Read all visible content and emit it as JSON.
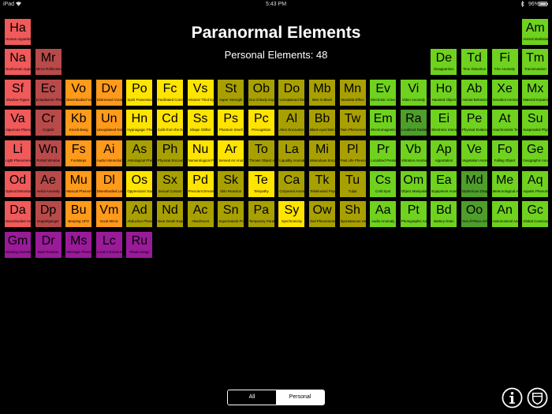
{
  "status_bar": {
    "device": "iPad",
    "time": "5:43 PM",
    "battery": "96%"
  },
  "header": {
    "title": "Paranormal Elements",
    "subtitle": "Personal Elements: 48"
  },
  "colors": {
    "red": "#F05A5A",
    "darkred": "#B84A4A",
    "orange": "#FF9A1A",
    "yellow": "#FFE400",
    "olive": "#A8A000",
    "darkolive": "#888800",
    "green": "#6FD21E",
    "darkgreen": "#4E9E2A",
    "purple": "#9A1A9A"
  },
  "elements": [
    {
      "s": "Ha",
      "n": "Human Apparition",
      "c": "red",
      "col": 0,
      "row": 0
    },
    {
      "s": "Am",
      "n": "Animal Mutilation",
      "c": "green",
      "col": 17,
      "row": 0
    },
    {
      "s": "Na",
      "n": "Nonhuman Apparition",
      "c": "red",
      "col": 0,
      "row": 1
    },
    {
      "s": "Mr",
      "n": "Mirror Reflection",
      "c": "darkred",
      "col": 1,
      "row": 1
    },
    {
      "s": "De",
      "n": "Disapparition",
      "c": "green",
      "col": 14,
      "row": 1
    },
    {
      "s": "Td",
      "n": "Time Distortion",
      "c": "green",
      "col": 15,
      "row": 1
    },
    {
      "s": "Fi",
      "n": "Fire Anomaly",
      "c": "green",
      "col": 16,
      "row": 1
    },
    {
      "s": "Tm",
      "n": "Transmutation",
      "c": "green",
      "col": 17,
      "row": 1
    },
    {
      "s": "Sf",
      "n": "Shadow Figure",
      "c": "red",
      "col": 0,
      "row": 2
    },
    {
      "s": "Ec",
      "n": "Ectoplasmic Phenomenon",
      "c": "darkred",
      "col": 1,
      "row": 2
    },
    {
      "s": "Vo",
      "n": "Disembodied Voice",
      "c": "orange",
      "col": 2,
      "row": 2
    },
    {
      "s": "Dv",
      "n": "Distressed Vocalization",
      "c": "orange",
      "col": 3,
      "row": 2
    },
    {
      "s": "Po",
      "n": "Spirit Possession",
      "c": "yellow",
      "col": 4,
      "row": 2
    },
    {
      "s": "Fc",
      "n": "Facilitated Communication",
      "c": "yellow",
      "col": 5,
      "row": 2
    },
    {
      "s": "Vs",
      "n": "Visions/ Third Eye",
      "c": "yellow",
      "col": 6,
      "row": 2
    },
    {
      "s": "St",
      "n": "Super Strength",
      "c": "olive",
      "col": 7,
      "row": 2
    },
    {
      "s": "Ob",
      "n": "Out of Body Experience",
      "c": "olive",
      "col": 8,
      "row": 2
    },
    {
      "s": "Do",
      "n": "Unexplained Disorientation",
      "c": "olive",
      "col": 9,
      "row": 2
    },
    {
      "s": "Mb",
      "n": "Men in Black",
      "c": "olive",
      "col": 10,
      "row": 2
    },
    {
      "s": "Mn",
      "n": "Mandela Effect",
      "c": "olive",
      "col": 11,
      "row": 2
    },
    {
      "s": "Ev",
      "n": "Electronic Voice Phenomenon",
      "c": "green",
      "col": 12,
      "row": 2
    },
    {
      "s": "Vi",
      "n": "Video Anomaly",
      "c": "green",
      "col": 13,
      "row": 2
    },
    {
      "s": "Ho",
      "n": "Haunted Object",
      "c": "green",
      "col": 14,
      "row": 2
    },
    {
      "s": "Ab",
      "n": "Animal Behavior",
      "c": "green",
      "col": 15,
      "row": 2
    },
    {
      "s": "Xe",
      "n": "Xenobiot Anomaly",
      "c": "green",
      "col": 16,
      "row": 2
    },
    {
      "s": "Mx",
      "n": "Material Expansion",
      "c": "green",
      "col": 17,
      "row": 2
    },
    {
      "s": "Va",
      "n": "Vaporous Phenomenon",
      "c": "red",
      "col": 0,
      "row": 3
    },
    {
      "s": "Cr",
      "n": "Cryptid",
      "c": "darkred",
      "col": 1,
      "row": 3
    },
    {
      "s": "Kb",
      "n": "Knock Bang",
      "c": "orange",
      "col": 2,
      "row": 3
    },
    {
      "s": "Un",
      "n": "Unexplained Noise",
      "c": "orange",
      "col": 3,
      "row": 3
    },
    {
      "s": "Hn",
      "n": "Hypnagogic Phenomenon",
      "c": "yellow",
      "col": 4,
      "row": 3
    },
    {
      "s": "Cd",
      "n": "Calls from the Dead",
      "c": "yellow",
      "col": 5,
      "row": 3
    },
    {
      "s": "Ss",
      "n": "Shape Shifter",
      "c": "yellow",
      "col": 6,
      "row": 3
    },
    {
      "s": "Ps",
      "n": "Phantom Smell",
      "c": "yellow",
      "col": 7,
      "row": 3
    },
    {
      "s": "Pc",
      "n": "Precognition",
      "c": "yellow",
      "col": 8,
      "row": 3
    },
    {
      "s": "Al",
      "n": "Alien Encounter",
      "c": "olive",
      "col": 9,
      "row": 3
    },
    {
      "s": "Bb",
      "n": "Black-eyed Being",
      "c": "olive",
      "col": 10,
      "row": 3
    },
    {
      "s": "Tw",
      "n": "Twin Phenomenon",
      "c": "olive",
      "col": 11,
      "row": 3
    },
    {
      "s": "Em",
      "n": "Electromagnetic Phenomenon",
      "c": "green",
      "col": 12,
      "row": 3
    },
    {
      "s": "Ra",
      "n": "Localized Radiation",
      "c": "darkgreen",
      "col": 13,
      "row": 3
    },
    {
      "s": "Ei",
      "n": "Electronic Interaction",
      "c": "green",
      "col": 14,
      "row": 3
    },
    {
      "s": "Pe",
      "n": "Physical Evidence",
      "c": "green",
      "col": 15,
      "row": 3
    },
    {
      "s": "At",
      "n": "Anachronistic Technology",
      "c": "green",
      "col": 16,
      "row": 3
    },
    {
      "s": "Su",
      "n": "Suspended Physics",
      "c": "green",
      "col": 17,
      "row": 3
    },
    {
      "s": "Li",
      "n": "Light Phenomenon",
      "c": "red",
      "col": 0,
      "row": 4
    },
    {
      "s": "Wn",
      "n": "Portal/ Window",
      "c": "darkred",
      "col": 1,
      "row": 4
    },
    {
      "s": "Fs",
      "n": "Footsteps",
      "c": "orange",
      "col": 2,
      "row": 4
    },
    {
      "s": "Ai",
      "n": "Audio Interaction",
      "c": "orange",
      "col": 3,
      "row": 4
    },
    {
      "s": "As",
      "n": "Astrological Phenomenon",
      "c": "olive",
      "col": 4,
      "row": 4
    },
    {
      "s": "Ph",
      "n": "Physical Encounter",
      "c": "olive",
      "col": 5,
      "row": 4
    },
    {
      "s": "Nu",
      "n": "Numerological Phenomenon",
      "c": "yellow",
      "col": 6,
      "row": 4
    },
    {
      "s": "Ar",
      "n": "Sensed Air Anomaly",
      "c": "yellow",
      "col": 7,
      "row": 4
    },
    {
      "s": "To",
      "n": "Thrown Object Assault",
      "c": "olive",
      "col": 8,
      "row": 4
    },
    {
      "s": "La",
      "n": "Liquidity Anomaly",
      "c": "olive",
      "col": 9,
      "row": 4
    },
    {
      "s": "Mi",
      "n": "Miraculous Encounter",
      "c": "olive",
      "col": 10,
      "row": 4
    },
    {
      "s": "Pl",
      "n": "Past Life Phenomenon",
      "c": "olive",
      "col": 11,
      "row": 4
    },
    {
      "s": "Pr",
      "n": "Localized Pressure Change",
      "c": "green",
      "col": 12,
      "row": 4
    },
    {
      "s": "Vb",
      "n": "Vibration Anomaly",
      "c": "green",
      "col": 13,
      "row": 4
    },
    {
      "s": "Ap",
      "n": "Apportation",
      "c": "green",
      "col": 14,
      "row": 4
    },
    {
      "s": "Ve",
      "n": "Vegetation Anomaly",
      "c": "green",
      "col": 15,
      "row": 4
    },
    {
      "s": "Fo",
      "n": "Falling Object",
      "c": "green",
      "col": 16,
      "row": 4
    },
    {
      "s": "Ge",
      "n": "Geographic Anomaly",
      "c": "green",
      "col": 17,
      "row": 4
    },
    {
      "s": "Od",
      "n": "Optical Distortion",
      "c": "red",
      "col": 0,
      "row": 5
    },
    {
      "s": "Ae",
      "n": "Aerial Anomaly",
      "c": "darkred",
      "col": 1,
      "row": 5
    },
    {
      "s": "Mu",
      "n": "Musical Phenomenon",
      "c": "orange",
      "col": 2,
      "row": 5
    },
    {
      "s": "Dl",
      "n": "Disembodied Laughter",
      "c": "orange",
      "col": 3,
      "row": 5
    },
    {
      "s": "Os",
      "n": "Oppression/ Sadness",
      "c": "yellow",
      "col": 4,
      "row": 5
    },
    {
      "s": "Sx",
      "n": "Sexual Contact",
      "c": "olive",
      "col": 5,
      "row": 5
    },
    {
      "s": "Pd",
      "n": "Prescient Dream",
      "c": "yellow",
      "col": 6,
      "row": 5
    },
    {
      "s": "Sk",
      "n": "Skin Reaction",
      "c": "olive",
      "col": 7,
      "row": 5
    },
    {
      "s": "Te",
      "n": "Telepathy",
      "c": "yellow",
      "col": 8,
      "row": 5
    },
    {
      "s": "Ca",
      "n": "Corporeal Anomaly",
      "c": "olive",
      "col": 9,
      "row": 5
    },
    {
      "s": "Tk",
      "n": "Telekinesis/ Psychokinesis",
      "c": "olive",
      "col": 10,
      "row": 5
    },
    {
      "s": "Tu",
      "n": "Tulpa",
      "c": "olive",
      "col": 11,
      "row": 5
    },
    {
      "s": "Cs",
      "n": "Cold Spot",
      "c": "green",
      "col": 12,
      "row": 5
    },
    {
      "s": "Om",
      "n": "Object Manipulation",
      "c": "green",
      "col": 13,
      "row": 5
    },
    {
      "s": "Ea",
      "n": "Equipment Anomaly",
      "c": "green",
      "col": 14,
      "row": 5
    },
    {
      "s": "Md",
      "n": "Mysterious Disappearance",
      "c": "darkgreen",
      "col": 15,
      "row": 5
    },
    {
      "s": "Me",
      "n": "Meteorological Anomaly",
      "c": "green",
      "col": 16,
      "row": 5
    },
    {
      "s": "Aq",
      "n": "Aquatic Phenomenon",
      "c": "green",
      "col": 17,
      "row": 5
    },
    {
      "s": "Da",
      "n": "Disembodied Anatomy",
      "c": "red",
      "col": 0,
      "row": 6
    },
    {
      "s": "Dp",
      "n": "Doppelganger",
      "c": "darkred",
      "col": 1,
      "row": 6
    },
    {
      "s": "Bu",
      "n": "Beeping UFO",
      "c": "orange",
      "col": 2,
      "row": 6
    },
    {
      "s": "Vm",
      "n": "Vocal Mimic",
      "c": "orange",
      "col": 3,
      "row": 6
    },
    {
      "s": "Ad",
      "n": "Abduction Phenomenon",
      "c": "olive",
      "col": 4,
      "row": 6
    },
    {
      "s": "Nd",
      "n": "Near Death Experience",
      "c": "olive",
      "col": 5,
      "row": 6
    },
    {
      "s": "Ac",
      "n": "Attachment",
      "c": "olive",
      "col": 6,
      "row": 6
    },
    {
      "s": "Sn",
      "n": "Supernatural Protection",
      "c": "olive",
      "col": 7,
      "row": 6
    },
    {
      "s": "Pa",
      "n": "Temporary Paralysis",
      "c": "olive",
      "col": 8,
      "row": 6
    },
    {
      "s": "Sy",
      "n": "Synchronicity",
      "c": "yellow",
      "col": 9,
      "row": 6
    },
    {
      "s": "Ow",
      "n": "Owl Phenomenon",
      "c": "olive",
      "col": 10,
      "row": 6
    },
    {
      "s": "Sh",
      "n": "Spontaneous Healing",
      "c": "olive",
      "col": 11,
      "row": 6
    },
    {
      "s": "Aa",
      "n": "Audio Anomaly",
      "c": "green",
      "col": 12,
      "row": 6
    },
    {
      "s": "Pt",
      "n": "Photographic Anomaly",
      "c": "green",
      "col": 13,
      "row": 6
    },
    {
      "s": "Bd",
      "n": "Battery Drain",
      "c": "green",
      "col": 14,
      "row": 6
    },
    {
      "s": "Oo",
      "n": "Out of Place Artifact",
      "c": "darkgreen",
      "col": 15,
      "row": 6
    },
    {
      "s": "An",
      "n": "Astronomical Anomaly",
      "c": "green",
      "col": 16,
      "row": 6
    },
    {
      "s": "Gc",
      "n": "Global Consciousness",
      "c": "green",
      "col": 17,
      "row": 6
    },
    {
      "s": "Gm",
      "n": "Glowing Gemstones",
      "c": "purple",
      "col": 0,
      "row": 7
    },
    {
      "s": "Dr",
      "n": "Dark Residue",
      "c": "purple",
      "col": 1,
      "row": 7
    },
    {
      "s": "Ms",
      "n": "Message Phenomenon",
      "c": "purple",
      "col": 2,
      "row": 7
    },
    {
      "s": "Lc",
      "n": "Lucid Consciousness",
      "c": "purple",
      "col": 3,
      "row": 7
    },
    {
      "s": "Ru",
      "n": "Ritual Usage",
      "c": "purple",
      "col": 4,
      "row": 7
    }
  ],
  "segmented_control": {
    "all_label": "All",
    "personal_label": "Personal",
    "selected": "Personal"
  },
  "icons": {
    "info": "info-icon",
    "badge": "shield-icon"
  }
}
